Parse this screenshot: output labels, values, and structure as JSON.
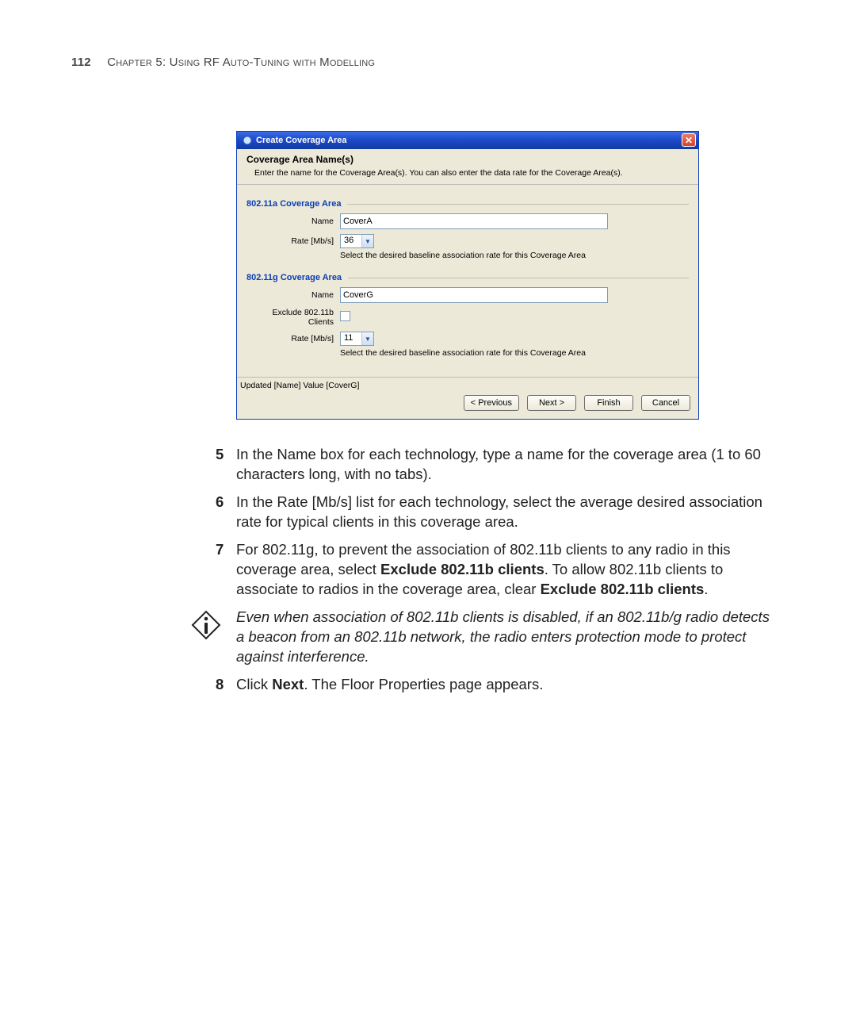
{
  "header": {
    "page_number": "112",
    "chapter": "Chapter 5: Using RF Auto-Tuning with Modelling"
  },
  "dialog": {
    "title": "Create Coverage Area",
    "close_glyph": "✕",
    "section_title": "Coverage Area Name(s)",
    "section_desc": "Enter the name for the Coverage Area(s). You can also enter the data rate for the Coverage Area(s).",
    "group_a": {
      "legend": "802.11a Coverage Area",
      "name_label": "Name",
      "name_value": "CoverA",
      "rate_label": "Rate [Mb/s]",
      "rate_value": "36",
      "rate_hint": "Select the desired baseline association rate for this Coverage Area"
    },
    "group_g": {
      "legend": "802.11g Coverage Area",
      "name_label": "Name",
      "name_value": "CoverG",
      "exclude_label": "Exclude 802.11b Clients",
      "rate_label": "Rate [Mb/s]",
      "rate_value": "11",
      "rate_hint": "Select the desired baseline association rate for this Coverage Area"
    },
    "status": "Updated [Name] Value [CoverG]",
    "buttons": {
      "previous": "< Previous",
      "next": "Next >",
      "finish": "Finish",
      "cancel": "Cancel"
    }
  },
  "steps": {
    "s5": {
      "num": "5",
      "text": "In the Name box for each technology, type a name for the coverage area (1 to 60 characters long, with no tabs)."
    },
    "s6": {
      "num": "6",
      "text": "In the Rate [Mb/s] list for each technology, select the average desired association rate for typical clients in this coverage area."
    },
    "s7": {
      "num": "7",
      "pre": "For 802.11g, to prevent the association of 802.11b clients to any radio in this coverage area, select ",
      "b1": "Exclude 802.11b clients",
      "mid": ". To allow 802.11b clients to associate to radios in the coverage area, clear ",
      "b2": "Exclude 802.11b clients",
      "post": "."
    },
    "note": "Even when association of 802.11b clients is disabled, if an 802.11b/g radio detects a beacon from an 802.11b network, the radio enters protection mode to protect against interference.",
    "s8": {
      "num": "8",
      "pre": "Click ",
      "b1": "Next",
      "post": ". The Floor Properties page appears."
    }
  }
}
